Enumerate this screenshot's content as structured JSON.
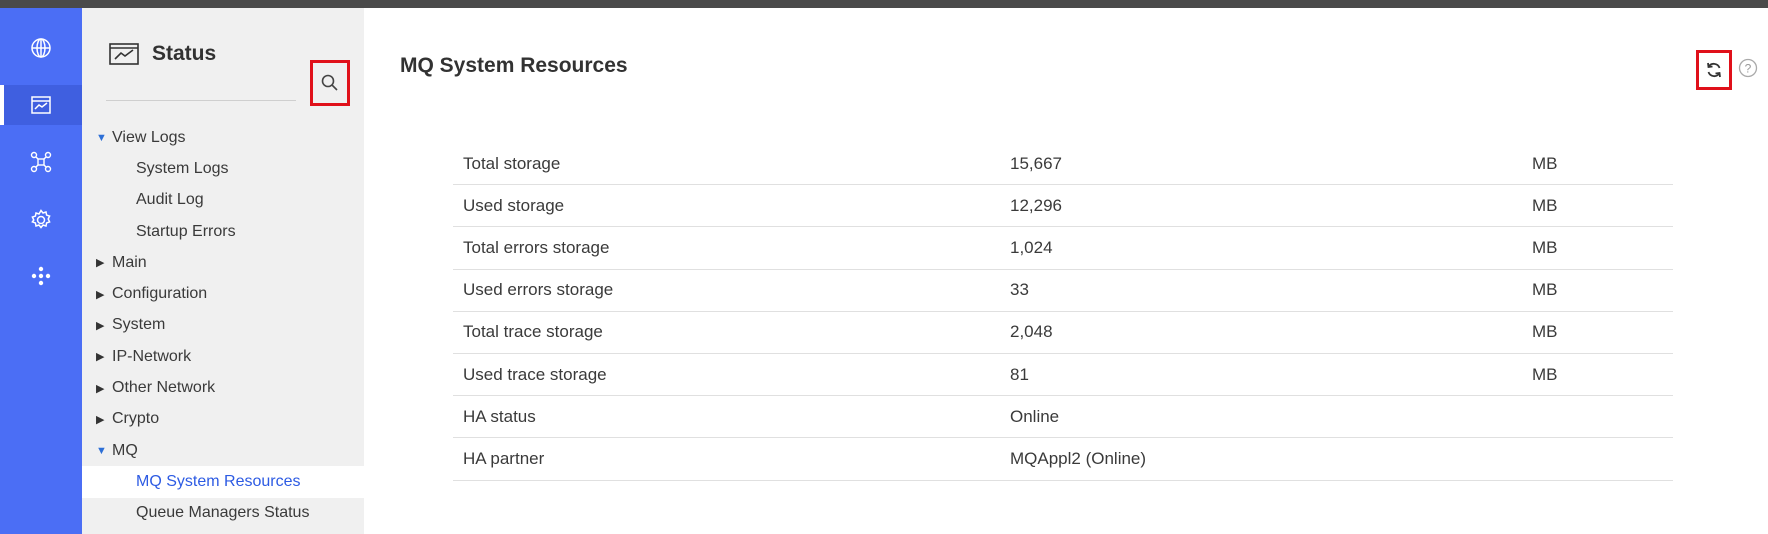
{
  "rail": {
    "items": [
      {
        "icon": "globe-icon"
      },
      {
        "icon": "status-monitor-icon",
        "active": true
      },
      {
        "icon": "network-icon"
      },
      {
        "icon": "gear-icon"
      },
      {
        "icon": "dots-icon"
      }
    ]
  },
  "sidebar": {
    "title": "Status",
    "search_icon": "search-icon",
    "nav": [
      {
        "label": "View Logs",
        "type": "group",
        "expanded": true
      },
      {
        "label": "System Logs",
        "type": "child"
      },
      {
        "label": "Audit Log",
        "type": "child"
      },
      {
        "label": "Startup Errors",
        "type": "child"
      },
      {
        "label": "Main",
        "type": "group",
        "expanded": false
      },
      {
        "label": "Configuration",
        "type": "group",
        "expanded": false
      },
      {
        "label": "System",
        "type": "group",
        "expanded": false
      },
      {
        "label": "IP-Network",
        "type": "group",
        "expanded": false
      },
      {
        "label": "Other Network",
        "type": "group",
        "expanded": false
      },
      {
        "label": "Crypto",
        "type": "group",
        "expanded": false
      },
      {
        "label": "MQ",
        "type": "group",
        "expanded": true
      },
      {
        "label": "MQ System Resources",
        "type": "child",
        "selected": true
      },
      {
        "label": "Queue Managers Status",
        "type": "child"
      }
    ]
  },
  "main": {
    "title": "MQ System Resources",
    "refresh_icon": "refresh-icon",
    "help_icon": "help-icon",
    "rows": [
      {
        "label": "Total storage",
        "value": "15,667",
        "unit": "MB"
      },
      {
        "label": "Used storage",
        "value": "12,296",
        "unit": "MB"
      },
      {
        "label": "Total errors storage",
        "value": "1,024",
        "unit": "MB"
      },
      {
        "label": "Used errors storage",
        "value": "33",
        "unit": "MB"
      },
      {
        "label": "Total trace storage",
        "value": "2,048",
        "unit": "MB"
      },
      {
        "label": "Used trace storage",
        "value": "81",
        "unit": "MB"
      },
      {
        "label": "HA status",
        "value": "Online",
        "unit": ""
      },
      {
        "label": "HA partner",
        "value": "MQAppl2 (Online)",
        "unit": ""
      }
    ]
  },
  "colors": {
    "rail": "#4b6ef5",
    "sidebar": "#f0f0f0",
    "selected_text": "#2d5be3",
    "highlight_box": "#e0101a"
  }
}
